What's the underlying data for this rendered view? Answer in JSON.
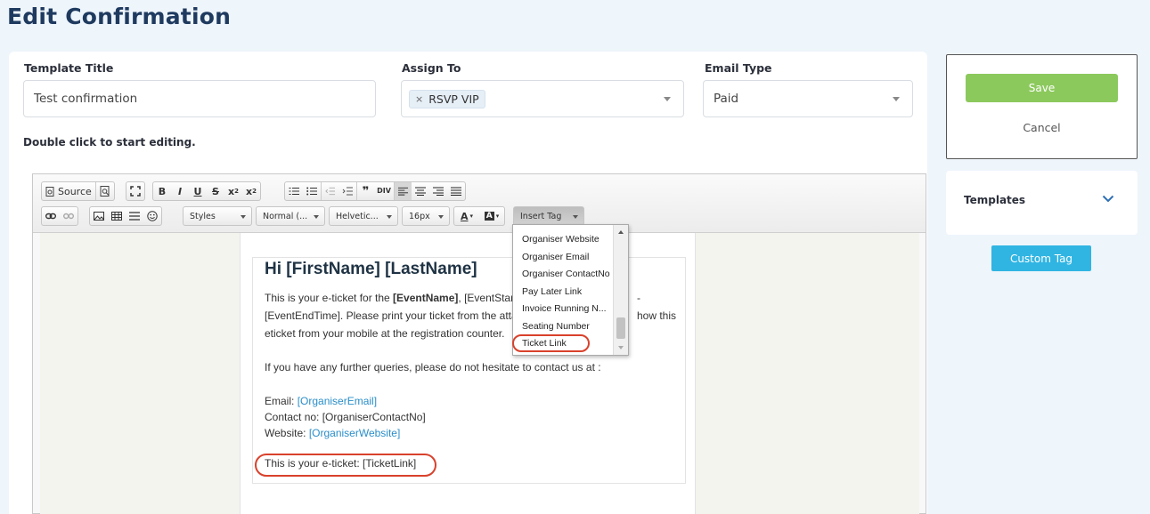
{
  "page_title": "Edit Confirmation",
  "form": {
    "template_title_label": "Template Title",
    "template_title_value": "Test confirmation",
    "assign_to_label": "Assign To",
    "assign_to_tag": "RSVP VIP",
    "assign_to_tag_remove": "×",
    "email_type_label": "Email Type",
    "email_type_value": "Paid",
    "hint": "Double click to start editing."
  },
  "toolbar": {
    "source": "Source",
    "styles": "Styles",
    "format": "Normal (...",
    "font": "Helvetic...",
    "size": "16px",
    "insert_tag": "Insert Tag"
  },
  "email": {
    "heading": "Hi [FirstName] [LastName]",
    "line1_a": "This is your e-ticket for the ",
    "line1_b": "[EventName]",
    "line1_c": ", [EventStar",
    "line1_d": "-",
    "line2_a": "[EventEndTime]. Please print your ticket from the atta",
    "line2_b": "how this",
    "line3": "eticket from your mobile at the registration counter.",
    "line4": "If you have any further queries, please do not hesitate to contact us at :",
    "email_label": "Email: ",
    "email_value": "[OrganiserEmail]",
    "contact": "Contact no: [OrganiserContactNo]",
    "website_label": "Website: ",
    "website_value": "[OrganiserWebsite]",
    "ticket_line": "This is your e-ticket: [TicketLink]"
  },
  "insert_tag_menu": [
    "Organiser Website",
    "Organiser Email",
    "Organiser ContactNo",
    "Pay Later Link",
    "Invoice Running N...",
    "Seating Number",
    "Ticket Link"
  ],
  "sidebar": {
    "save": "Save",
    "cancel": "Cancel",
    "templates": "Templates",
    "custom_tag": "Custom Tag"
  },
  "colors": {
    "save": "#8cc95d",
    "custom_tag": "#30b5e3",
    "highlight_ring": "#d9412c",
    "link": "#2a8ec9"
  }
}
